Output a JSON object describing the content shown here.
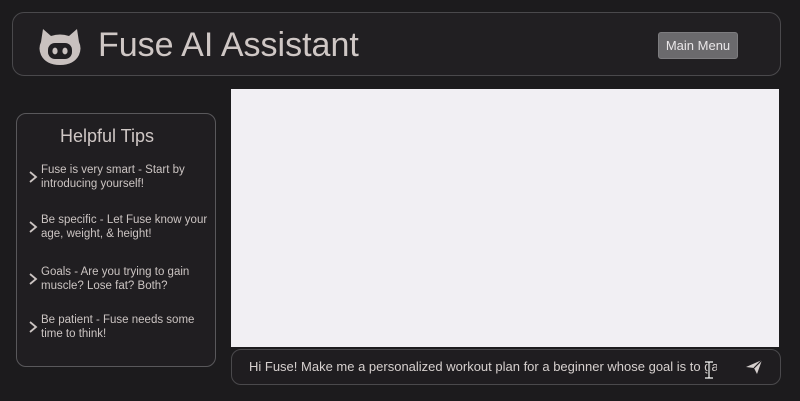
{
  "header": {
    "title": "Fuse AI Assistant",
    "menu_label": "Main Menu",
    "logo_icon": "github-octocat-icon"
  },
  "tips": {
    "title": "Helpful Tips",
    "items": [
      {
        "text": "Fuse is very smart - Start by introducing yourself!"
      },
      {
        "text": "Be specific - Let Fuse know your age, weight, & height!"
      },
      {
        "text": "Goals - Are you trying to gain muscle? Lose fat? Both?"
      },
      {
        "text": "Be patient - Fuse needs some time to think!"
      }
    ]
  },
  "chat": {
    "input_value": "Hi Fuse! Make me a personalized workout plan for a beginner whose goal is to gain mu",
    "send_icon": "send-icon"
  },
  "colors": {
    "background": "#1c1b1d",
    "panel_border": "#4a494c",
    "text": "#cfc7c5",
    "chat_area": "#f1eff3"
  }
}
